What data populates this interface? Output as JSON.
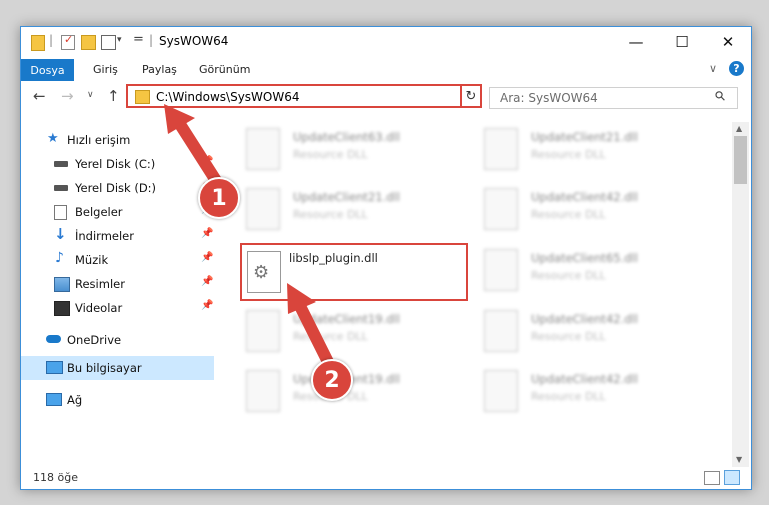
{
  "window": {
    "title": "SysWOW64",
    "minimize": "—",
    "maximize": "☐",
    "close": "✕"
  },
  "ribbon": {
    "tabs": [
      "Dosya",
      "Giriş",
      "Paylaş",
      "Görünüm"
    ],
    "expand": "∨",
    "help": "?"
  },
  "nav": {
    "back": "←",
    "forward": "→",
    "recent": "∨",
    "up": "↑",
    "address": "C:\\Windows\\SysWOW64",
    "address_dropdown": "∨",
    "refresh": "↻",
    "search_placeholder": "Ara: SysWOW64",
    "search_icon": "⚲"
  },
  "sidebar": {
    "items": [
      {
        "label": "Hızlı erişim",
        "icon": "star-icon",
        "pinned": false
      },
      {
        "label": "Yerel Disk (C:)",
        "icon": "drive-icon",
        "pinned": true
      },
      {
        "label": "Yerel Disk (D:)",
        "icon": "drive-icon",
        "pinned": true
      },
      {
        "label": "Belgeler",
        "icon": "documents-icon",
        "pinned": true
      },
      {
        "label": "İndirmeler",
        "icon": "download-icon",
        "pinned": true
      },
      {
        "label": "Müzik",
        "icon": "music-icon",
        "pinned": true
      },
      {
        "label": "Resimler",
        "icon": "pictures-icon",
        "pinned": true
      },
      {
        "label": "Videolar",
        "icon": "videos-icon",
        "pinned": true
      },
      {
        "label": "OneDrive",
        "icon": "cloud-icon",
        "pinned": false
      },
      {
        "label": "Bu bilgisayar",
        "icon": "computer-icon",
        "pinned": false
      },
      {
        "label": "Ağ",
        "icon": "network-icon",
        "pinned": false
      }
    ],
    "pin_glyph": "📌"
  },
  "files": {
    "left": [
      {
        "name": "UpdateClient63.dll",
        "type": "Resource DLL"
      },
      {
        "name": "UpdateClient21.dll",
        "type": "Resource DLL"
      },
      {
        "name": "libslp_plugin.dll",
        "type": ""
      },
      {
        "name": "UpdateClient19.dll",
        "type": "Resource DLL"
      },
      {
        "name": "UpdateClient19.dll",
        "type": "Resource DLL"
      }
    ],
    "right": [
      {
        "name": "UpdateClient21.dll",
        "type": "Resource DLL"
      },
      {
        "name": "UpdateClient42.dll",
        "type": "Resource DLL"
      },
      {
        "name": "UpdateClient65.dll",
        "type": "Resource DLL"
      },
      {
        "name": "UpdateClient42.dll",
        "type": "Resource DLL"
      },
      {
        "name": "UpdateClient42.dll",
        "type": "Resource DLL"
      }
    ]
  },
  "status": {
    "item_count": "118 öğe"
  },
  "callouts": {
    "step1": "1",
    "step2": "2"
  },
  "colors": {
    "accent": "#1979ca",
    "highlight": "#d9453c",
    "selection": "#cce8ff"
  }
}
